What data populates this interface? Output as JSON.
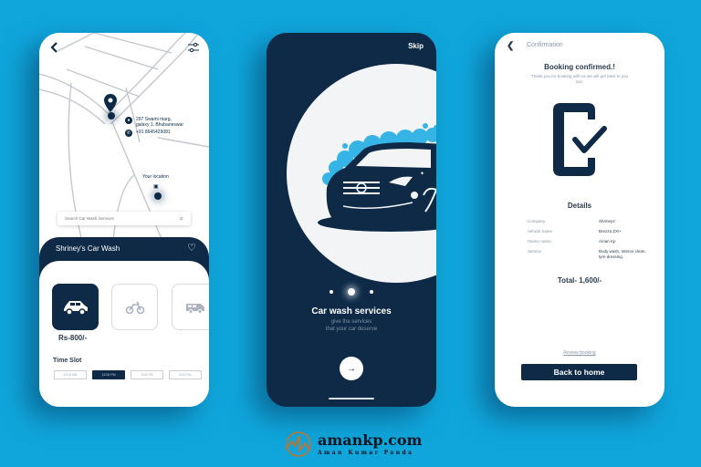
{
  "colors": {
    "background": "#10a6db",
    "primary_navy": "#0e2a47",
    "bubble_blue": "#37b4e6",
    "brand_orange": "#c8702a"
  },
  "screen_map": {
    "back_icon": "chevron-left-icon",
    "filter_icon": "sliders-icon",
    "address_line1": "297 Swami marg,",
    "address_line2": "galaxy 1, Bhubaneswar",
    "phone": "+91  8645429081",
    "your_location_label": "Your location",
    "search_placeholder": "Search Car Wash Services",
    "shop_name": "Shriney's Car Wash",
    "vehicles": [
      {
        "name": "car",
        "icon": "car-icon",
        "selected": true
      },
      {
        "name": "bike",
        "icon": "motorbike-icon",
        "selected": false
      },
      {
        "name": "van",
        "icon": "van-icon",
        "selected": false
      }
    ],
    "price": "Rs-800/-",
    "time_slot_title": "Time Slot",
    "time_slots": [
      {
        "label": "10:00 AM",
        "selected": false
      },
      {
        "label": "12:00 PM",
        "selected": true
      },
      {
        "label": "3:00 PM",
        "selected": false
      },
      {
        "label": "6:00 PM",
        "selected": false
      }
    ]
  },
  "screen_onboarding": {
    "skip_label": "Skip",
    "page_index": 2,
    "page_count": 3,
    "title": "Car wash services",
    "subtitle_line1": "give the services",
    "subtitle_line2": "that your car deserve",
    "next_icon": "arrow-right-icon"
  },
  "screen_confirmation": {
    "header_title": "Confirmation",
    "heading": "Booking confirmed.!",
    "subtext": "Thank you for booking with us we will get back to you son.",
    "details_title": "Details",
    "details": [
      {
        "key": "Company",
        "value": "Shrineys'"
      },
      {
        "key": "Vehicle name",
        "value": "Brezza ZXI+"
      },
      {
        "key": "Owner name",
        "value": "Aman Kp"
      },
      {
        "key": "Service",
        "value": "Body wash, Interior clean, tyre dressing."
      }
    ],
    "total": "Total- 1,600/-",
    "review_link": "Review booking",
    "home_button": "Back to home"
  },
  "brand": {
    "site": "amankp.com",
    "author": "Aman Kumar Panda"
  }
}
